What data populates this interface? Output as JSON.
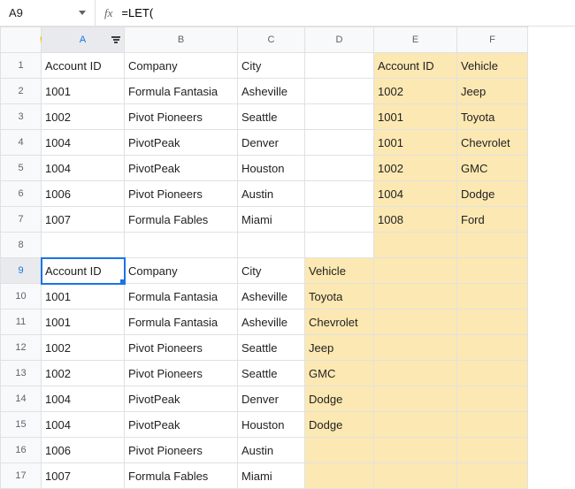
{
  "nameBox": {
    "ref": "A9"
  },
  "formula": {
    "fxLabel": "fx",
    "value": "=LET("
  },
  "columns": [
    "A",
    "B",
    "C",
    "D",
    "E",
    "F"
  ],
  "selection": {
    "col": "A",
    "row": 9
  },
  "rows": [
    {
      "n": 1,
      "A": "Account ID",
      "B": "Company",
      "C": "City",
      "D": "",
      "E": "Account ID",
      "F": "Vehicle",
      "hl": {
        "E": true,
        "F": true
      }
    },
    {
      "n": 2,
      "A": "1001",
      "B": "Formula Fantasia",
      "C": "Asheville",
      "D": "",
      "E": "1002",
      "F": "Jeep",
      "numA": true,
      "numE": true,
      "hl": {
        "E": true,
        "F": true
      }
    },
    {
      "n": 3,
      "A": "1002",
      "B": "Pivot Pioneers",
      "C": "Seattle",
      "D": "",
      "E": "1001",
      "F": "Toyota",
      "numA": true,
      "numE": true,
      "hl": {
        "E": true,
        "F": true
      }
    },
    {
      "n": 4,
      "A": "1004",
      "B": "PivotPeak",
      "C": "Denver",
      "D": "",
      "E": "1001",
      "F": "Chevrolet",
      "numA": true,
      "numE": true,
      "hl": {
        "E": true,
        "F": true
      }
    },
    {
      "n": 5,
      "A": "1004",
      "B": "PivotPeak",
      "C": "Houston",
      "D": "",
      "E": "1002",
      "F": "GMC",
      "numA": true,
      "numE": true,
      "hl": {
        "E": true,
        "F": true
      }
    },
    {
      "n": 6,
      "A": "1006",
      "B": "Pivot Pioneers",
      "C": "Austin",
      "D": "",
      "E": "1004",
      "F": "Dodge",
      "numA": true,
      "numE": true,
      "hl": {
        "E": true,
        "F": true
      }
    },
    {
      "n": 7,
      "A": "1007",
      "B": "Formula Fables",
      "C": "Miami",
      "D": "",
      "E": "1008",
      "F": "Ford",
      "numA": true,
      "numE": true,
      "hl": {
        "E": true,
        "F": true
      }
    },
    {
      "n": 8,
      "A": "",
      "B": "",
      "C": "",
      "D": "",
      "E": "",
      "F": "",
      "hl": {
        "E": true,
        "F": true
      }
    },
    {
      "n": 9,
      "A": "Account ID",
      "B": "Company",
      "C": "City",
      "D": "Vehicle",
      "E": "",
      "F": "",
      "hl": {
        "D": true,
        "E": true,
        "F": true
      }
    },
    {
      "n": 10,
      "A": "1001",
      "B": "Formula Fantasia",
      "C": "Asheville",
      "D": "Toyota",
      "E": "",
      "F": "",
      "numA": true,
      "hl": {
        "D": true,
        "E": true,
        "F": true
      }
    },
    {
      "n": 11,
      "A": "1001",
      "B": "Formula Fantasia",
      "C": "Asheville",
      "D": "Chevrolet",
      "E": "",
      "F": "",
      "numA": true,
      "hl": {
        "D": true,
        "E": true,
        "F": true
      }
    },
    {
      "n": 12,
      "A": "1002",
      "B": "Pivot Pioneers",
      "C": "Seattle",
      "D": "Jeep",
      "E": "",
      "F": "",
      "numA": true,
      "hl": {
        "D": true,
        "E": true,
        "F": true
      }
    },
    {
      "n": 13,
      "A": "1002",
      "B": "Pivot Pioneers",
      "C": "Seattle",
      "D": "GMC",
      "E": "",
      "F": "",
      "numA": true,
      "hl": {
        "D": true,
        "E": true,
        "F": true
      }
    },
    {
      "n": 14,
      "A": "1004",
      "B": "PivotPeak",
      "C": "Denver",
      "D": "Dodge",
      "E": "",
      "F": "",
      "numA": true,
      "hl": {
        "D": true,
        "E": true,
        "F": true
      }
    },
    {
      "n": 15,
      "A": "1004",
      "B": "PivotPeak",
      "C": "Houston",
      "D": "Dodge",
      "E": "",
      "F": "",
      "numA": true,
      "hl": {
        "D": true,
        "E": true,
        "F": true
      }
    },
    {
      "n": 16,
      "A": "1006",
      "B": "Pivot Pioneers",
      "C": "Austin",
      "D": "",
      "E": "",
      "F": "",
      "numA": true,
      "hl": {
        "D": true,
        "E": true,
        "F": true
      }
    },
    {
      "n": 17,
      "A": "1007",
      "B": "Formula Fables",
      "C": "Miami",
      "D": "",
      "E": "",
      "F": "",
      "numA": true,
      "hl": {
        "D": true,
        "E": true,
        "F": true
      }
    }
  ],
  "chart_data": {
    "type": "table",
    "tables": [
      {
        "name": "source_accounts",
        "columns": [
          "Account ID",
          "Company",
          "City"
        ],
        "rows": [
          [
            1001,
            "Formula Fantasia",
            "Asheville"
          ],
          [
            1002,
            "Pivot Pioneers",
            "Seattle"
          ],
          [
            1004,
            "PivotPeak",
            "Denver"
          ],
          [
            1004,
            "PivotPeak",
            "Houston"
          ],
          [
            1006,
            "Pivot Pioneers",
            "Austin"
          ],
          [
            1007,
            "Formula Fables",
            "Miami"
          ]
        ]
      },
      {
        "name": "lookup_vehicles",
        "columns": [
          "Account ID",
          "Vehicle"
        ],
        "rows": [
          [
            1002,
            "Jeep"
          ],
          [
            1001,
            "Toyota"
          ],
          [
            1001,
            "Chevrolet"
          ],
          [
            1002,
            "GMC"
          ],
          [
            1004,
            "Dodge"
          ],
          [
            1008,
            "Ford"
          ]
        ]
      },
      {
        "name": "result_joined",
        "columns": [
          "Account ID",
          "Company",
          "City",
          "Vehicle"
        ],
        "rows": [
          [
            1001,
            "Formula Fantasia",
            "Asheville",
            "Toyota"
          ],
          [
            1001,
            "Formula Fantasia",
            "Asheville",
            "Chevrolet"
          ],
          [
            1002,
            "Pivot Pioneers",
            "Seattle",
            "Jeep"
          ],
          [
            1002,
            "Pivot Pioneers",
            "Seattle",
            "GMC"
          ],
          [
            1004,
            "PivotPeak",
            "Denver",
            "Dodge"
          ],
          [
            1004,
            "PivotPeak",
            "Houston",
            "Dodge"
          ],
          [
            1006,
            "Pivot Pioneers",
            "Austin",
            null
          ],
          [
            1007,
            "Formula Fables",
            "Miami",
            null
          ]
        ]
      }
    ]
  }
}
